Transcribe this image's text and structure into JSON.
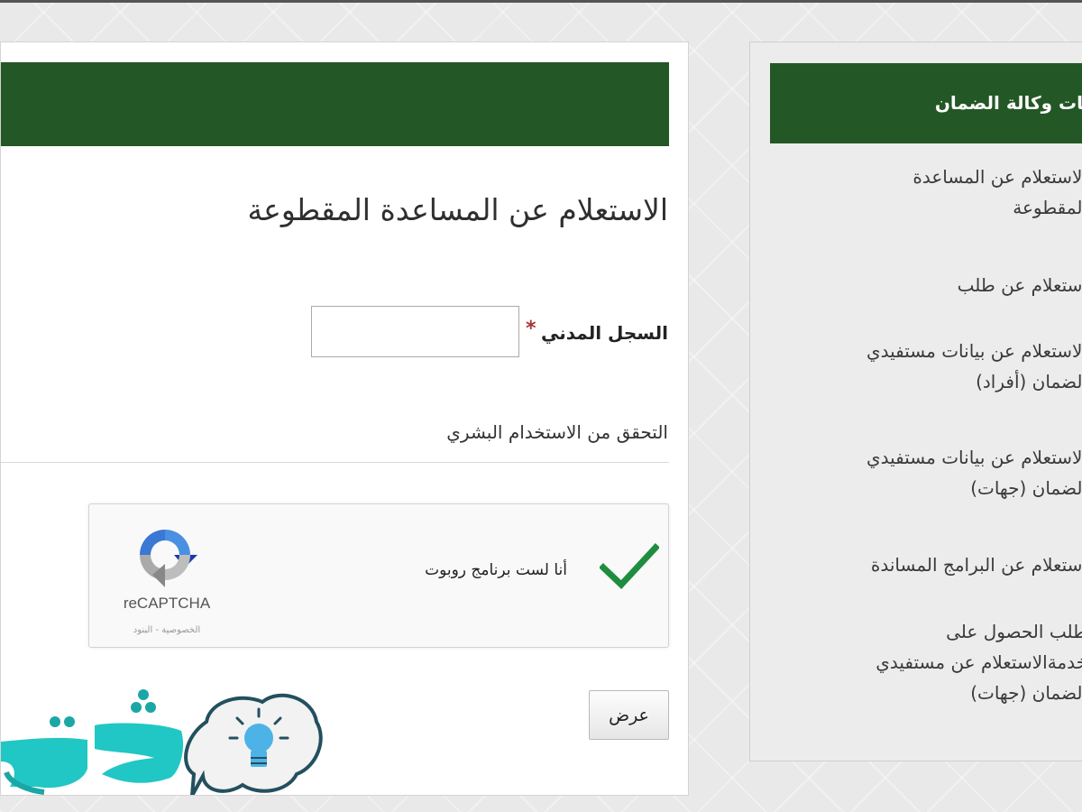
{
  "main": {
    "page_title": "الاستعلام عن المساعدة المقطوعة",
    "civil_label": "السجل المدني",
    "required_mark": "*",
    "civil_value": "",
    "human_heading": "التحقق من الاستخدام البشري",
    "captcha": {
      "label": "أنا لست برنامج روبوت",
      "brand": "reCAPTCHA",
      "links": "الخصوصية - البنود"
    },
    "submit_label": "عرض"
  },
  "sidebar": {
    "title": "...مات وكالة الضمان",
    "title_visible": "مات وكالة الضمان",
    "items": [
      {
        "label": "الاستعلام عن المساعدة\nالمقطوعة"
      },
      {
        "label": "استعلام عن طلب"
      },
      {
        "label": "الاستعلام عن بيانات مستفيدي\nالضمان (أفراد)"
      },
      {
        "label": "الاستعلام عن بيانات مستفيدي\nالضمان (جهات)"
      },
      {
        "label": "استعلام عن البرامج المساندة"
      },
      {
        "label": "طلب الحصول على\nخدمةالاستعلام عن مستفيدي\nالضمان (جهات)"
      }
    ]
  },
  "colors": {
    "banner_green": "#245726",
    "check_green": "#1e8e3e",
    "page_bg": "#e9e9e9"
  },
  "icons": {
    "captcha_check": "checkmark-icon",
    "captcha_logo": "recaptcha-logo",
    "site_logo": "lightbulb-bubble-logo"
  }
}
